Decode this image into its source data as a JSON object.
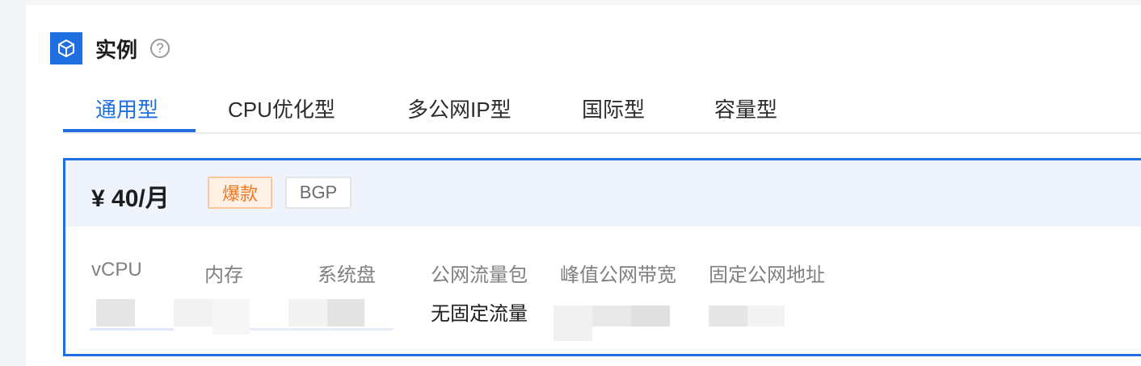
{
  "header": {
    "title": "实例",
    "help_glyph": "?",
    "icon": "cube-icon"
  },
  "tabs": [
    {
      "label": "通用型",
      "active": true
    },
    {
      "label": "CPU优化型",
      "active": false
    },
    {
      "label": "多公网IP型",
      "active": false
    },
    {
      "label": "国际型",
      "active": false
    },
    {
      "label": "容量型",
      "active": false
    }
  ],
  "card": {
    "price": "¥ 40/月",
    "tags": [
      "爆款",
      "BGP"
    ],
    "specs": [
      {
        "label": "vCPU",
        "value": ""
      },
      {
        "label": "内存",
        "value": ""
      },
      {
        "label": "系统盘",
        "value": ""
      },
      {
        "label": "公网流量包",
        "value": "无固定流量"
      },
      {
        "label": "峰值公网带宽",
        "value": ""
      },
      {
        "label": "固定公网地址",
        "value": ""
      }
    ]
  },
  "colors": {
    "accent": "#1f6fe0",
    "hot_tag_text": "#f2761b",
    "card_header_bg": "#eef3fc"
  }
}
